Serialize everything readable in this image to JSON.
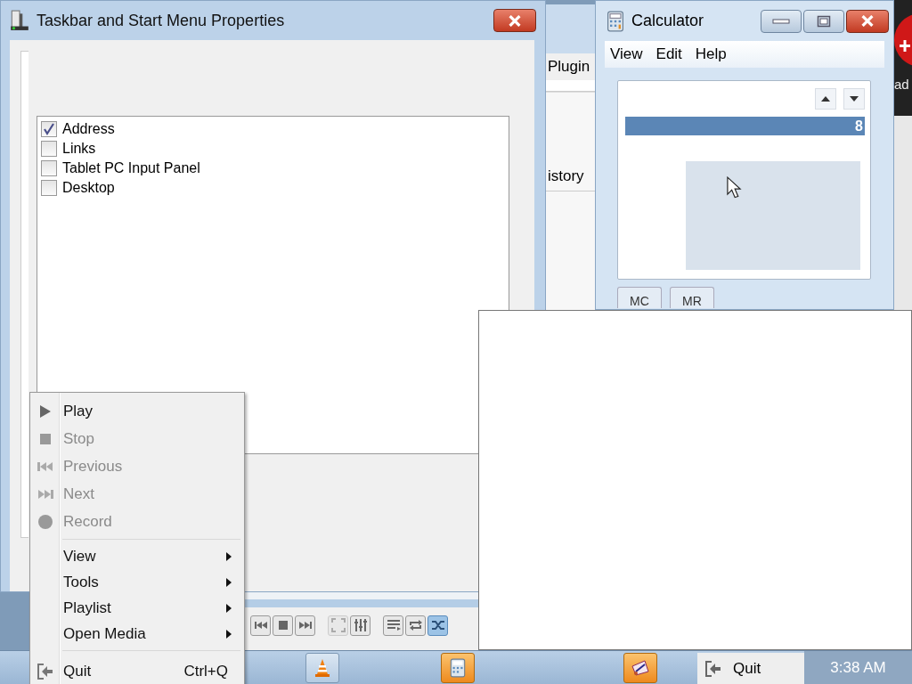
{
  "vlc_window": {
    "menu_fragment": "Plugin",
    "tab_fragment": "istory",
    "shuffle_on": true
  },
  "properties_window": {
    "title": "Taskbar and Start Menu Properties",
    "toolbars": [
      {
        "label": "Address",
        "checked": true
      },
      {
        "label": "Links",
        "checked": false
      },
      {
        "label": "Tablet PC Input Panel",
        "checked": false
      },
      {
        "label": "Desktop",
        "checked": false
      }
    ]
  },
  "side_window": {
    "text_fragment": "ad"
  },
  "calculator": {
    "title": "Calculator",
    "menu": [
      "View",
      "Edit",
      "Help"
    ],
    "history_value": "8",
    "memory_buttons": [
      "MC",
      "MR"
    ]
  },
  "context_menu": {
    "items": [
      {
        "kind": "action",
        "label": "Play",
        "disabled": false
      },
      {
        "kind": "action",
        "label": "Stop",
        "disabled": true
      },
      {
        "kind": "action",
        "label": "Previous",
        "disabled": true
      },
      {
        "kind": "action",
        "label": "Next",
        "disabled": true
      },
      {
        "kind": "action",
        "label": "Record",
        "disabled": true
      },
      {
        "kind": "separator"
      },
      {
        "kind": "submenu",
        "label": "View"
      },
      {
        "kind": "submenu",
        "label": "Tools"
      },
      {
        "kind": "submenu",
        "label": "Playlist"
      },
      {
        "kind": "submenu",
        "label": "Open Media"
      },
      {
        "kind": "separator"
      },
      {
        "kind": "quit",
        "label": "Quit",
        "shortcut": "Ctrl+Q"
      }
    ]
  },
  "taskbar": {
    "tray_item": "Quit",
    "clock": "3:38 AM"
  }
}
